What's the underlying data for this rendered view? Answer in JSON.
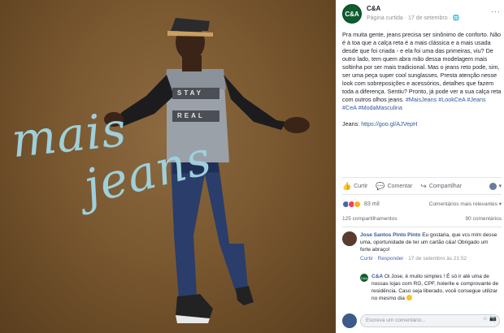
{
  "photo": {
    "script_line1": "mais",
    "script_line2": "jeans",
    "shirt_text1": "STAY",
    "shirt_text2": "REAL"
  },
  "post": {
    "page_name": "C&A",
    "logo_text": "C&A",
    "meta": "Página curtida · 17 de setembro · 🌐",
    "menu": "···",
    "body": "Pra muita gente, jeans precisa ser sinônimo de conforto. Não é à toa que a calça reta é a mais clássica e a mais usada desde que foi criada - e ela foi uma das primeiras, viu? De outro lado, tem quem abra mão dessa modelagem mais soltinha por ser mais tradicional. Mas o jeans reto pode, sim, ser uma peça super cool sunglasses. Presta atenção nesse look com sobreposições e acessórios, detalhes que fazem toda a diferença. Sentiu? Pronto, já pode ver a sua calça reta com outros olhos jeans.",
    "hashtags": "#MaisJeans #LookCeA #Jeans #CeA #ModaMasculina",
    "link_label": "Jeans: ",
    "link_url": "https://goo.gl/AJVepH"
  },
  "actions": {
    "like": "Curtir",
    "comment": "Comentar",
    "share": "Compartilhar"
  },
  "reactions": {
    "count": "83 mil",
    "relevance": "Comentários mais relevantes ▾"
  },
  "counts": {
    "shares": "125 compartilhamentos",
    "comments": "90 comentários"
  },
  "comments": [
    {
      "author": "Jose Santos Pinto Pinto",
      "text": "Eu gostaria, que vcs mim desse uma, oportunidade de ter um cartão c&a! Obrigado um forte abraço!",
      "like": "Curtir",
      "reply": "Responder",
      "time": "17 de setembro às 21:52"
    }
  ],
  "reply": {
    "author": "C&A",
    "avatar_text": "C&A",
    "text": "Oi Jose, é muito simples ! É só ir até uma de nossas lojas com RG, CPF, holerite e comprovante de residência. Caso seja liberado, você consegue utilizar no mesmo dia"
  },
  "composer": {
    "placeholder": "Escreva um comentário...",
    "icons": "☺ 📷"
  },
  "colors": {
    "brand_green": "#0f5c2f",
    "link_blue": "#365899",
    "photo_bg": "#7a5830",
    "script_blue": "#9ed0dc"
  }
}
